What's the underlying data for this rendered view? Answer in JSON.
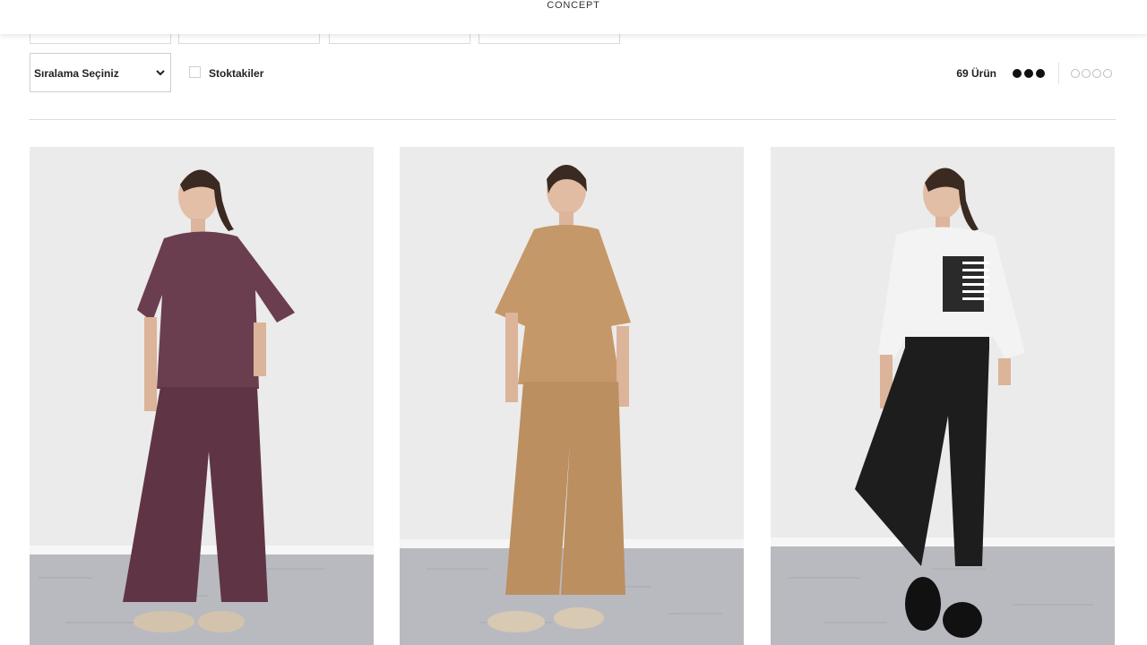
{
  "header": {
    "brand_subtitle": "CONCEPT"
  },
  "toolbar": {
    "sort_label": "Sıralama Seçiniz",
    "stock_label": "Stoktakiler",
    "stock_checked": false,
    "product_count": "69 Ürün",
    "view_options": [
      {
        "icon": "grid-3-column-icon",
        "active": true
      },
      {
        "icon": "grid-5-column-icon",
        "active": false
      }
    ]
  },
  "products": [
    {
      "image": "model in plum short-sleeve top and wide-leg trousers",
      "top_color": "#6a3e4f",
      "bottom_color": "#5f3546"
    },
    {
      "image": "model in camel short-sleeve top and wide-leg trousers",
      "top_color": "#c49868",
      "bottom_color": "#bb8f60"
    },
    {
      "image": "model in white shirt with black-striped pocket and black trousers",
      "top_color": "#f3f3f3",
      "bottom_color": "#1d1d1d"
    }
  ]
}
